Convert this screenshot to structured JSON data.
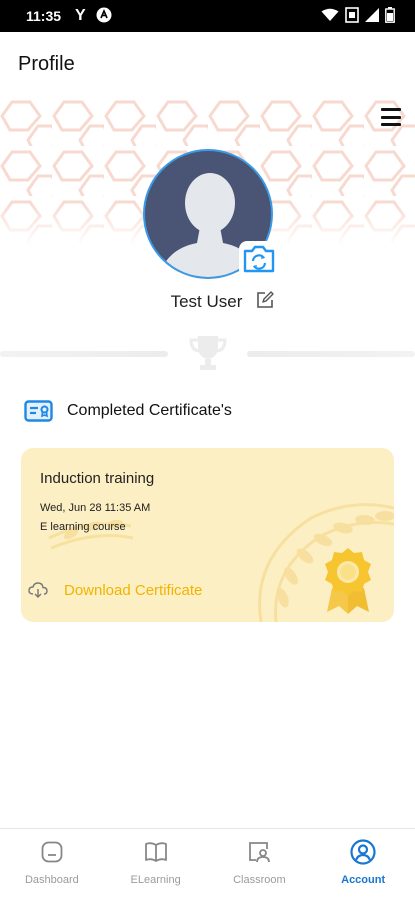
{
  "status_bar": {
    "time": "11:35",
    "left_icons": [
      "yahoo-icon",
      "app-notification-icon"
    ],
    "right_icons": [
      "wifi-icon",
      "sim-icon",
      "signal-icon",
      "battery-icon"
    ]
  },
  "header": {
    "title": "Profile"
  },
  "profile": {
    "user_name": "Test User",
    "icons": [
      "menu-icon",
      "camera-icon",
      "edit-icon",
      "trophy-icon"
    ]
  },
  "certificates": {
    "section_title": "Completed Certificate's",
    "items": [
      {
        "title": "Induction training",
        "date": "Wed, Jun 28 11:35 AM",
        "type": "E learning course",
        "download_label": "Download Certificate"
      }
    ]
  },
  "nav": {
    "items": [
      {
        "label": "Dashboard",
        "icon": "dashboard-icon",
        "active": false
      },
      {
        "label": "ELearning",
        "icon": "book-icon",
        "active": false
      },
      {
        "label": "Classroom",
        "icon": "classroom-icon",
        "active": false
      },
      {
        "label": "Account",
        "icon": "account-icon",
        "active": true
      }
    ]
  },
  "colors": {
    "accent": "#1976d2",
    "avatar_bg": "#4a5474",
    "card_bg": "#fdefc4",
    "download": "#f0b400",
    "pattern": "#f7d9cf"
  }
}
